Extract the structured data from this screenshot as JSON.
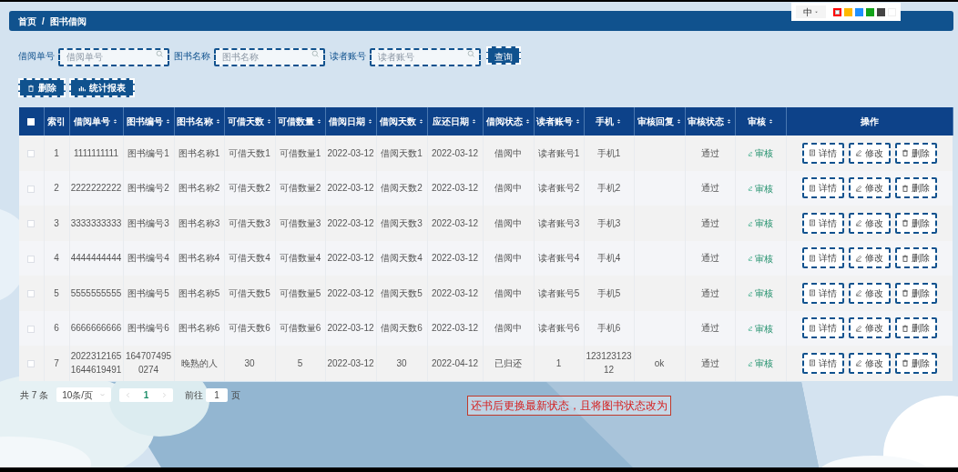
{
  "breadcrumb": {
    "items": [
      "首页",
      "图书借阅"
    ],
    "separator": "/"
  },
  "annotation_toolbar": {
    "size_label": "中",
    "colors": [
      {
        "color": "#ff0000",
        "selected": true
      },
      {
        "color": "#ffb800",
        "selected": false
      },
      {
        "color": "#1e90ff",
        "selected": false
      },
      {
        "color": "#13a31a",
        "selected": false
      },
      {
        "color": "#444444",
        "selected": false
      },
      {
        "color": "#ffffff",
        "selected": false
      }
    ]
  },
  "filters": [
    {
      "label": "借阅单号",
      "placeholder": "借阅单号"
    },
    {
      "label": "图书名称",
      "placeholder": "图书名称"
    },
    {
      "label": "读者账号",
      "placeholder": "读者账号"
    }
  ],
  "search_button": "查询",
  "actions": [
    {
      "kind": "delete",
      "label": "删除"
    },
    {
      "kind": "report",
      "label": "统计报表"
    }
  ],
  "table": {
    "header_checked": false,
    "columns": [
      {
        "label": "索引",
        "sortable": false
      },
      {
        "label": "借阅单号",
        "sortable": true
      },
      {
        "label": "图书编号",
        "sortable": true
      },
      {
        "label": "图书名称",
        "sortable": true
      },
      {
        "label": "可借天数",
        "sortable": true
      },
      {
        "label": "可借数量",
        "sortable": true
      },
      {
        "label": "借阅日期",
        "sortable": true
      },
      {
        "label": "借阅天数",
        "sortable": true
      },
      {
        "label": "应还日期",
        "sortable": true
      },
      {
        "label": "借阅状态",
        "sortable": true
      },
      {
        "label": "读者账号",
        "sortable": true
      },
      {
        "label": "手机",
        "sortable": true
      },
      {
        "label": "审核回复",
        "sortable": true
      },
      {
        "label": "审核状态",
        "sortable": true
      },
      {
        "label": "审核",
        "sortable": true
      },
      {
        "label": "操作",
        "sortable": false
      }
    ],
    "rows": [
      {
        "checked": false,
        "cells": [
          "1",
          "1111111111",
          "图书编号1",
          "图书名称1",
          "可借天数1",
          "可借数量1",
          "2022-03-12",
          "借阅天数1",
          "2022-03-12",
          "借阅中",
          "读者账号1",
          "手机1",
          null,
          "通过"
        ],
        "review": "审核",
        "actions": [
          {
            "kind": "detail",
            "label": "详情"
          },
          {
            "kind": "edit",
            "label": "修改"
          },
          {
            "kind": "delete",
            "label": "删除"
          }
        ]
      },
      {
        "checked": false,
        "cells": [
          "2",
          "2222222222",
          "图书编号2",
          "图书名称2",
          "可借天数2",
          "可借数量2",
          "2022-03-12",
          "借阅天数2",
          "2022-03-12",
          "借阅中",
          "读者账号2",
          "手机2",
          null,
          "通过"
        ],
        "review": "审核",
        "actions": [
          {
            "kind": "detail",
            "label": "详情"
          },
          {
            "kind": "edit",
            "label": "修改"
          },
          {
            "kind": "delete",
            "label": "删除"
          }
        ]
      },
      {
        "checked": false,
        "cells": [
          "3",
          "3333333333",
          "图书编号3",
          "图书名称3",
          "可借天数3",
          "可借数量3",
          "2022-03-12",
          "借阅天数3",
          "2022-03-12",
          "借阅中",
          "读者账号3",
          "手机3",
          null,
          "通过"
        ],
        "review": "审核",
        "actions": [
          {
            "kind": "detail",
            "label": "详情"
          },
          {
            "kind": "edit",
            "label": "修改"
          },
          {
            "kind": "delete",
            "label": "删除"
          }
        ]
      },
      {
        "checked": false,
        "cells": [
          "4",
          "4444444444",
          "图书编号4",
          "图书名称4",
          "可借天数4",
          "可借数量4",
          "2022-03-12",
          "借阅天数4",
          "2022-03-12",
          "借阅中",
          "读者账号4",
          "手机4",
          null,
          "通过"
        ],
        "review": "审核",
        "actions": [
          {
            "kind": "detail",
            "label": "详情"
          },
          {
            "kind": "edit",
            "label": "修改"
          },
          {
            "kind": "delete",
            "label": "删除"
          }
        ]
      },
      {
        "checked": false,
        "cells": [
          "5",
          "5555555555",
          "图书编号5",
          "图书名称5",
          "可借天数5",
          "可借数量5",
          "2022-03-12",
          "借阅天数5",
          "2022-03-12",
          "借阅中",
          "读者账号5",
          "手机5",
          null,
          "通过"
        ],
        "review": "审核",
        "actions": [
          {
            "kind": "detail",
            "label": "详情"
          },
          {
            "kind": "edit",
            "label": "修改"
          },
          {
            "kind": "delete",
            "label": "删除"
          }
        ]
      },
      {
        "checked": false,
        "cells": [
          "6",
          "6666666666",
          "图书编号6",
          "图书名称6",
          "可借天数6",
          "可借数量6",
          "2022-03-12",
          "借阅天数6",
          "2022-03-12",
          "借阅中",
          "读者账号6",
          "手机6",
          null,
          "通过"
        ],
        "review": "审核",
        "actions": [
          {
            "kind": "detail",
            "label": "详情"
          },
          {
            "kind": "edit",
            "label": "修改"
          },
          {
            "kind": "delete",
            "label": "删除"
          }
        ]
      },
      {
        "checked": false,
        "cells": [
          "7",
          "20223121651644619491",
          "1647074950274",
          "晚熟的人",
          "30",
          "5",
          "2022-03-12",
          "30",
          "2022-04-12",
          "已归还",
          "1",
          "12312312312",
          "ok",
          "通过"
        ],
        "review": "审核",
        "actions": [
          {
            "kind": "detail",
            "label": "详情"
          },
          {
            "kind": "edit",
            "label": "修改"
          },
          {
            "kind": "delete",
            "label": "删除"
          }
        ]
      }
    ]
  },
  "pagination": {
    "total": "共 7 条",
    "page_size": "10条/页",
    "pages": [
      {
        "label": "1",
        "selected": true
      }
    ],
    "goto_label": "前往",
    "goto_value": "1",
    "page_suffix": "页"
  },
  "note": "还书后更换最新状态，且将图书状态改为"
}
